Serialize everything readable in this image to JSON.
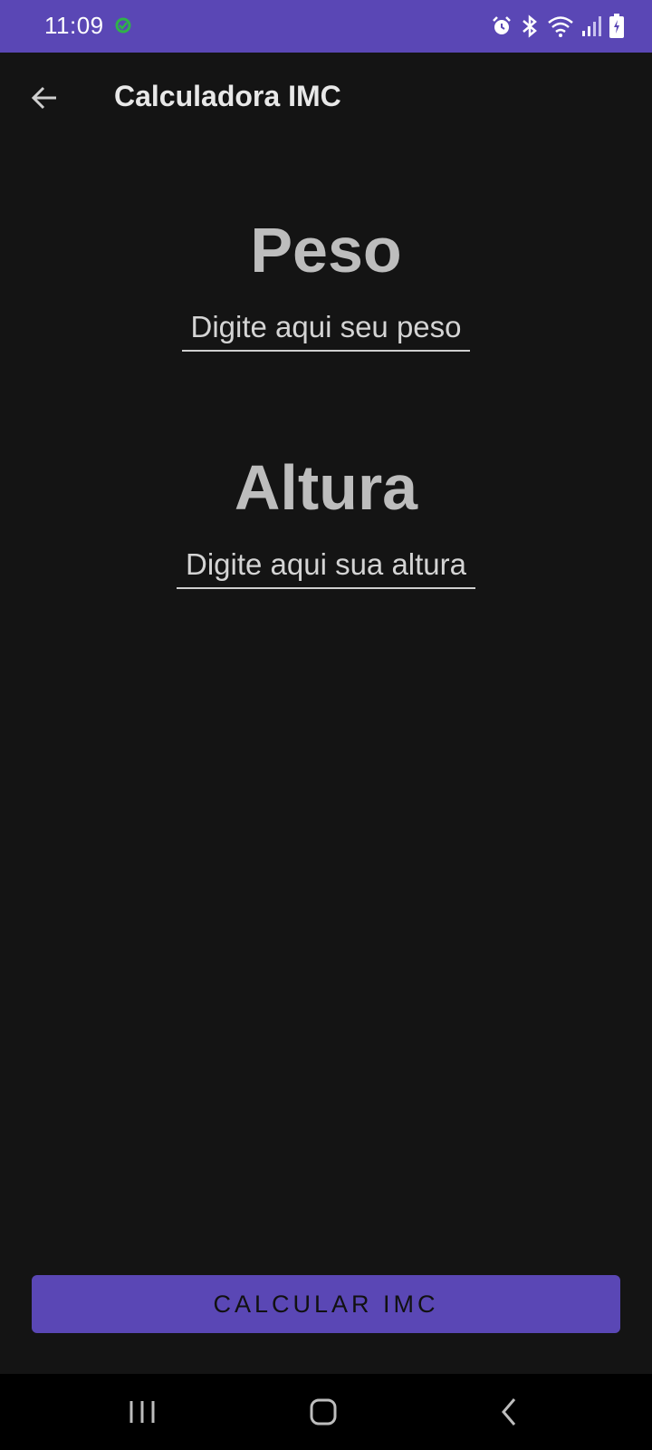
{
  "status_bar": {
    "time": "11:09",
    "icons": [
      "sync-icon",
      "alarm-icon",
      "bluetooth-icon",
      "wifi-icon",
      "signal-icon",
      "battery-icon"
    ],
    "color": "#5a47b5"
  },
  "app_bar": {
    "title": "Calculadora IMC"
  },
  "weight": {
    "title": "Peso",
    "placeholder": "Digite aqui seu peso",
    "value": ""
  },
  "height": {
    "title": "Altura",
    "placeholder": "Digite aqui sua altura",
    "value": ""
  },
  "actions": {
    "calculate_label": "CALCULAR IMC",
    "button_color": "#5a47b5"
  },
  "nav_bar": {
    "buttons": [
      "recents-icon",
      "home-icon",
      "back-icon"
    ]
  }
}
